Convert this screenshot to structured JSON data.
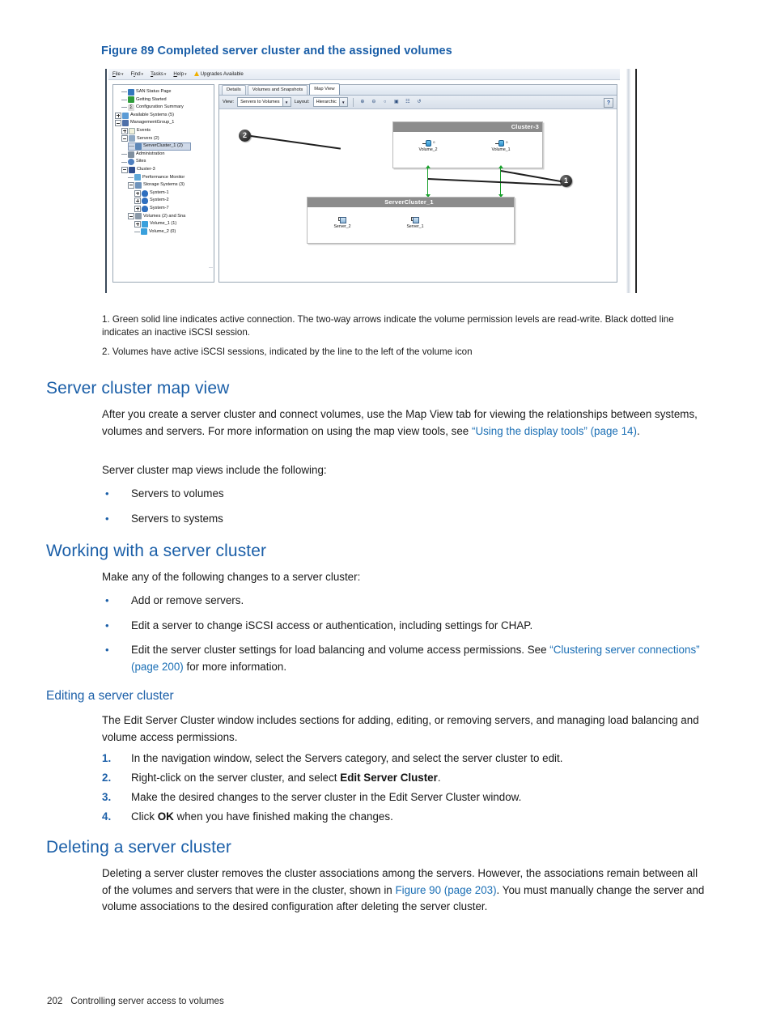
{
  "figure": {
    "caption": "Figure 89 Completed server cluster and the assigned volumes",
    "app": {
      "menubar": [
        {
          "label": "File",
          "caret": "▾"
        },
        {
          "label": "Find",
          "caret": "▾"
        },
        {
          "label": "Tasks",
          "caret": "▾"
        },
        {
          "label": "Help",
          "caret": "▾"
        },
        {
          "label": "Upgrades Available",
          "icon": "warning-triangle-icon"
        }
      ],
      "tree": [
        {
          "label": "SAN Status Page",
          "icon": "home-icon",
          "depth": 1,
          "toggle": "none"
        },
        {
          "label": "Getting Started",
          "icon": "arrow-right-icon",
          "depth": 1,
          "toggle": "none"
        },
        {
          "label": "Configuration Summary",
          "icon": "sigma-icon",
          "depth": 1,
          "toggle": "none"
        },
        {
          "label": "Available Systems (5)",
          "icon": "cloud-icon",
          "depth": 0,
          "toggle": "plus"
        },
        {
          "label": "ManagementGroup_1",
          "icon": "management-group-icon",
          "depth": 0,
          "toggle": "minus"
        },
        {
          "label": "Events",
          "icon": "events-icon",
          "depth": 1,
          "toggle": "plus"
        },
        {
          "label": "Servers (2)",
          "icon": "servers-icon",
          "depth": 1,
          "toggle": "minus"
        },
        {
          "label": "ServerCluster_1 (2)",
          "icon": "server-cluster-icon",
          "depth": 2,
          "toggle": "none",
          "selected": true
        },
        {
          "label": "Administration",
          "icon": "administration-icon",
          "depth": 1,
          "toggle": "none"
        },
        {
          "label": "Sites",
          "icon": "sites-icon",
          "depth": 1,
          "toggle": "none"
        },
        {
          "label": "Cluster-3",
          "icon": "cluster-icon",
          "depth": 1,
          "toggle": "minus"
        },
        {
          "label": "Performance Monitor",
          "icon": "performance-monitor-icon",
          "depth": 2,
          "toggle": "none"
        },
        {
          "label": "Storage Systems (3)",
          "icon": "storage-systems-icon",
          "depth": 2,
          "toggle": "minus"
        },
        {
          "label": "System-1",
          "icon": "system-icon",
          "depth": 3,
          "toggle": "plus"
        },
        {
          "label": "System-2",
          "icon": "system-icon",
          "depth": 3,
          "toggle": "plus"
        },
        {
          "label": "System-7",
          "icon": "system-icon",
          "depth": 3,
          "toggle": "plus"
        },
        {
          "label": "Volumes (2) and Sna",
          "icon": "volumes-icon",
          "depth": 2,
          "toggle": "minus"
        },
        {
          "label": "Volume_1 (1)",
          "icon": "volume-icon",
          "depth": 3,
          "toggle": "plus"
        },
        {
          "label": "Volume_2 (0)",
          "icon": "volume-icon",
          "depth": 3,
          "toggle": "none"
        }
      ],
      "tabs": [
        {
          "label": "Details",
          "active": false
        },
        {
          "label": "Volumes and Snapshots",
          "active": false
        },
        {
          "label": "Map View",
          "active": true
        }
      ],
      "toolbar": {
        "view_label": "View:",
        "view_value": "Servers to Volumes",
        "layout_label": "Layout:",
        "layout_value": "Hierarchic",
        "buttons": [
          {
            "name": "zoom-in-icon",
            "glyph": "⊕"
          },
          {
            "name": "zoom-out-icon",
            "glyph": "⊖"
          },
          {
            "name": "zoom-fit-icon",
            "glyph": "○"
          },
          {
            "name": "fit-to-window-icon",
            "glyph": "▣"
          },
          {
            "name": "layout-tree-icon",
            "glyph": "☷"
          },
          {
            "name": "refresh-icon",
            "glyph": "↺"
          }
        ],
        "help_glyph": "?"
      },
      "map": {
        "cluster_box": {
          "title": "Cluster-3"
        },
        "server_box": {
          "title": "ServerCluster_1"
        },
        "volumes": [
          {
            "label": "Volume_2",
            "badge": "0"
          },
          {
            "label": "Volume_1",
            "badge": "0"
          }
        ],
        "servers": [
          {
            "label": "Server_2"
          },
          {
            "label": "Server_1"
          }
        ],
        "callouts": [
          {
            "label": "1"
          },
          {
            "label": "2"
          }
        ]
      }
    },
    "footnotes": [
      "1. Green solid line indicates active connection. The two-way arrows indicate the volume permission levels are read-write. Black dotted line indicates an inactive iSCSI session.",
      "2. Volumes have active iSCSI sessions, indicated by the line to the left of the volume icon"
    ]
  },
  "sections": {
    "map_view": {
      "heading": "Server cluster map view",
      "para_1_before": "After you create a server cluster and connect volumes, use the Map View tab for viewing the relationships between systems, volumes and servers. For more information on using the map view tools, see ",
      "para_1_link": "“Using the display tools” (page 14)",
      "para_1_after": ".",
      "para_2": "Server cluster map views include the following:",
      "bullets": [
        {
          "bullet": "•",
          "text": "Servers to volumes"
        },
        {
          "bullet": "•",
          "text": "Servers to systems"
        }
      ]
    },
    "working": {
      "heading": "Working with a server cluster",
      "intro": "Make any of the following changes to a server cluster:",
      "bullets": [
        {
          "bullet": "•",
          "text": "Add or remove servers."
        },
        {
          "bullet": "•",
          "text": "Edit a server to change iSCSI access or authentication, including settings for CHAP."
        },
        {
          "bullet": "•",
          "text_before": "Edit the server cluster settings for load balancing and volume access permissions. See ",
          "link": "“Clustering server connections” (page 200)",
          "text_after": " for more information."
        }
      ]
    },
    "editing": {
      "heading": "Editing a server cluster",
      "intro": "The Edit Server Cluster window includes sections for adding, editing, or removing servers, and managing load balancing and volume access permissions.",
      "steps": [
        {
          "num": "1.",
          "text": "In the navigation window, select the Servers category, and select the server cluster to edit."
        },
        {
          "num": "2.",
          "before": "Right-click on the server cluster, and select ",
          "bold": "Edit Server Cluster",
          "after": "."
        },
        {
          "num": "3.",
          "text": "Make the desired changes to the server cluster in the Edit Server Cluster window."
        },
        {
          "num": "4.",
          "before": "Click ",
          "bold": "OK",
          "after": " when you have finished making the changes."
        }
      ]
    },
    "deleting": {
      "heading": "Deleting a server cluster",
      "para_before": "Deleting a server cluster removes the cluster associations among the servers. However, the associations remain between all of the volumes and servers that were in the cluster, shown in ",
      "para_link": "Figure 90 (page 203)",
      "para_after": ". You must manually change the server and volume associations to the desired configuration after deleting the server cluster."
    }
  },
  "footer": {
    "page_number": "202",
    "chapter": "Controlling server access to volumes"
  },
  "colors": {
    "heading_blue": "#1b5fa8",
    "link_blue": "#1b6fb5",
    "map_title_gray": "#8c8c8c",
    "active_line_green": "#18a02b"
  }
}
